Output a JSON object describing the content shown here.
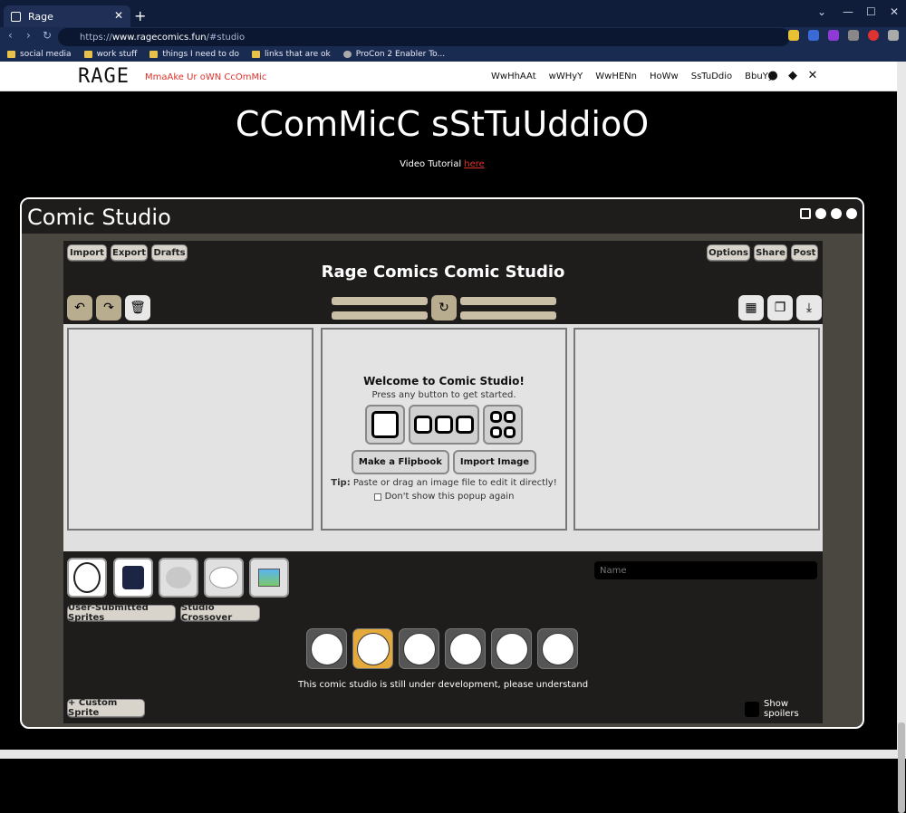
{
  "browser": {
    "tab_title": "Rage",
    "url_prefix": "https://",
    "url_host": "www.ragecomics.fun",
    "url_path": "/#studio",
    "bookmarks": [
      "social media",
      "work stuff",
      "things I need to do",
      "links that are ok",
      "ProCon 2 Enabler To..."
    ]
  },
  "site": {
    "logo": "RAGE",
    "tagline": "MmaAke Ur oWN CcOmMic",
    "nav": [
      "WwHhAAt",
      "wWHyY",
      "WwHENn",
      "HoWw",
      "SsTuDdio",
      "BbuYy"
    ],
    "hero_title": "CComMicC sStTuUddioO",
    "video_prefix": "Video Tutorial",
    "video_link": "here"
  },
  "studio": {
    "title": "Comic Studio",
    "top_left_buttons": [
      "Import",
      "Export",
      "Drafts"
    ],
    "top_right_buttons": [
      "Options",
      "Share",
      "Post"
    ],
    "comic_title": "Rage Comics Comic Studio",
    "popup": {
      "title": "Welcome to Comic Studio!",
      "subtitle": "Press any button to get started.",
      "flipbook_button": "Make a Flipbook",
      "import_button": "Import Image",
      "tip_label": "Tip:",
      "tip_text": "Paste or drag an image file to edit it directly!",
      "dont_show": "Don't show this popup again"
    },
    "name_placeholder": "Name",
    "category_buttons": [
      "User-Submitted Sprites",
      "Studio Crossover"
    ],
    "dev_note": "This comic studio is still under development, please understand",
    "custom_sprite_button": "+ Custom Sprite",
    "show_spoilers": "Show spoilers"
  }
}
